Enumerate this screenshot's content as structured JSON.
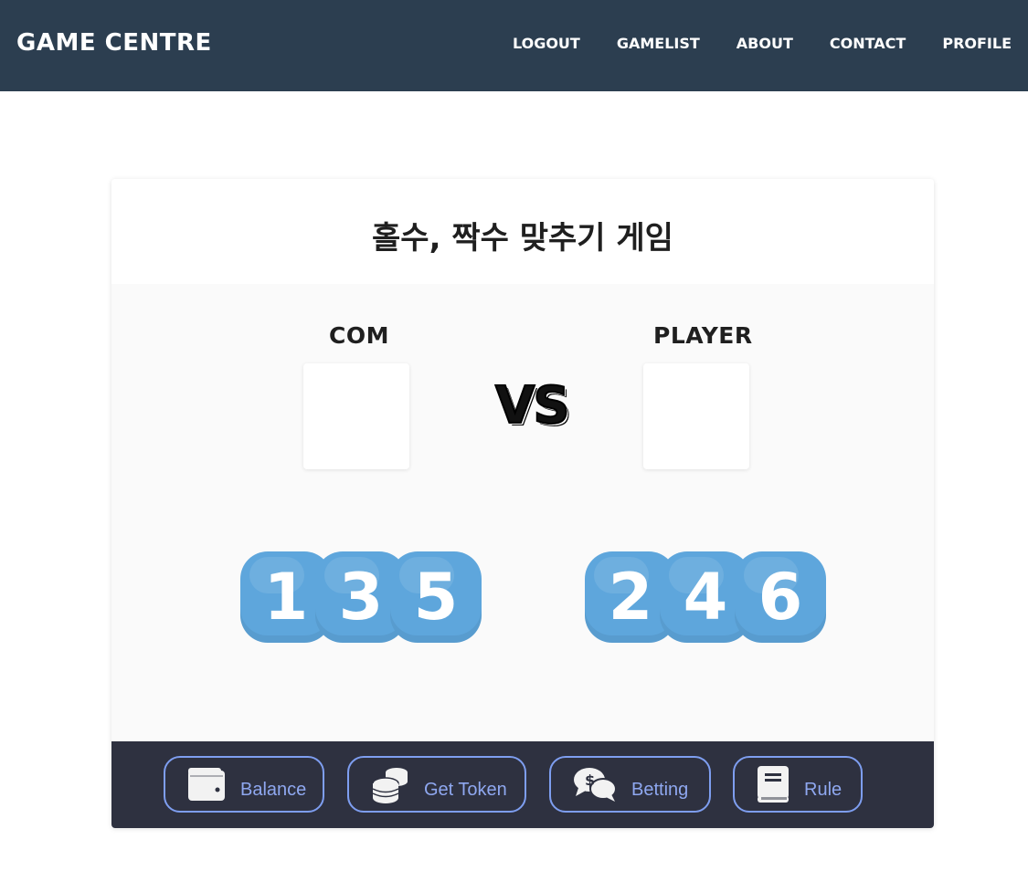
{
  "navbar": {
    "brand": "GAME CENTRE",
    "links": [
      "LOGOUT",
      "GAMELIST",
      "ABOUT",
      "CONTACT",
      "PROFILE"
    ]
  },
  "game": {
    "title": "홀수, 짝수 맞추기 게임",
    "com_label": "COM",
    "player_label": "PLAYER",
    "vs_label": "VS",
    "odd_dice": [
      "1",
      "3",
      "5"
    ],
    "even_dice": [
      "2",
      "4",
      "6"
    ]
  },
  "footer": {
    "buttons": [
      {
        "label": "Balance",
        "icon": "wallet-icon"
      },
      {
        "label": "Get Token",
        "icon": "coins-icon"
      },
      {
        "label": "Betting",
        "icon": "comments-dollar-icon"
      },
      {
        "label": "Rule",
        "icon": "book-icon"
      }
    ]
  },
  "colors": {
    "navbar_bg": "#2c3e50",
    "footer_bg": "#2e3140",
    "dice_blue": "#5ea6dc",
    "button_border": "#7e9ef0"
  }
}
